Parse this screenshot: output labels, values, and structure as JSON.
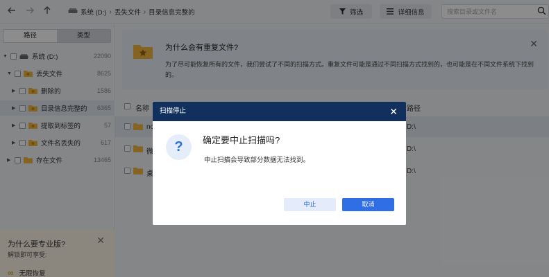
{
  "toolbar": {
    "breadcrumb": [
      "系统 (D:)",
      "丢失文件",
      "目录信息完整的"
    ],
    "filter_label": "筛选",
    "detail_label": "详细信息",
    "search_placeholder": "搜索目录或文件名"
  },
  "sidebar": {
    "tabs": [
      "路径",
      "类型"
    ],
    "tree": [
      {
        "label": "系统 (D:)",
        "count": "22090"
      },
      {
        "label": "丢失文件",
        "count": "8625"
      },
      {
        "label": "删除的",
        "count": "1586"
      },
      {
        "label": "目录信息完整的",
        "count": "6365"
      },
      {
        "label": "提取到标签的",
        "count": "57"
      },
      {
        "label": "文件名丢失的",
        "count": "617"
      },
      {
        "label": "存在文件",
        "count": "13465"
      }
    ],
    "promo": {
      "title": "为什么要专业版?",
      "subtitle": "解锁即可享受:",
      "feature": "无限恢复"
    }
  },
  "main": {
    "info": {
      "title": "为什么会有重复文件?",
      "text": "为了尽可能恢复所有的文件，我们尝试了不同的扫描方式。重复文件可能是通过不同扫描方式找到的，也可能是在不同文件系统下找到的。"
    },
    "columns": {
      "name": "名称",
      "path": "路径"
    },
    "rows": [
      {
        "name": "nc",
        "path": "D:\\"
      },
      {
        "name": "微",
        "path": "D:\\"
      },
      {
        "name": "桌",
        "path": "D:\\"
      }
    ]
  },
  "dialog": {
    "header": "扫描停止",
    "title": "确定要中止扫描吗?",
    "message": "中止扫描会导致部分数据无法找到。",
    "stop_label": "中止",
    "cancel_label": "取消",
    "icon": "question-icon"
  },
  "colors": {
    "dialog_header": "#12305d",
    "primary": "#2f6ee5",
    "folder": "#f2b441"
  }
}
